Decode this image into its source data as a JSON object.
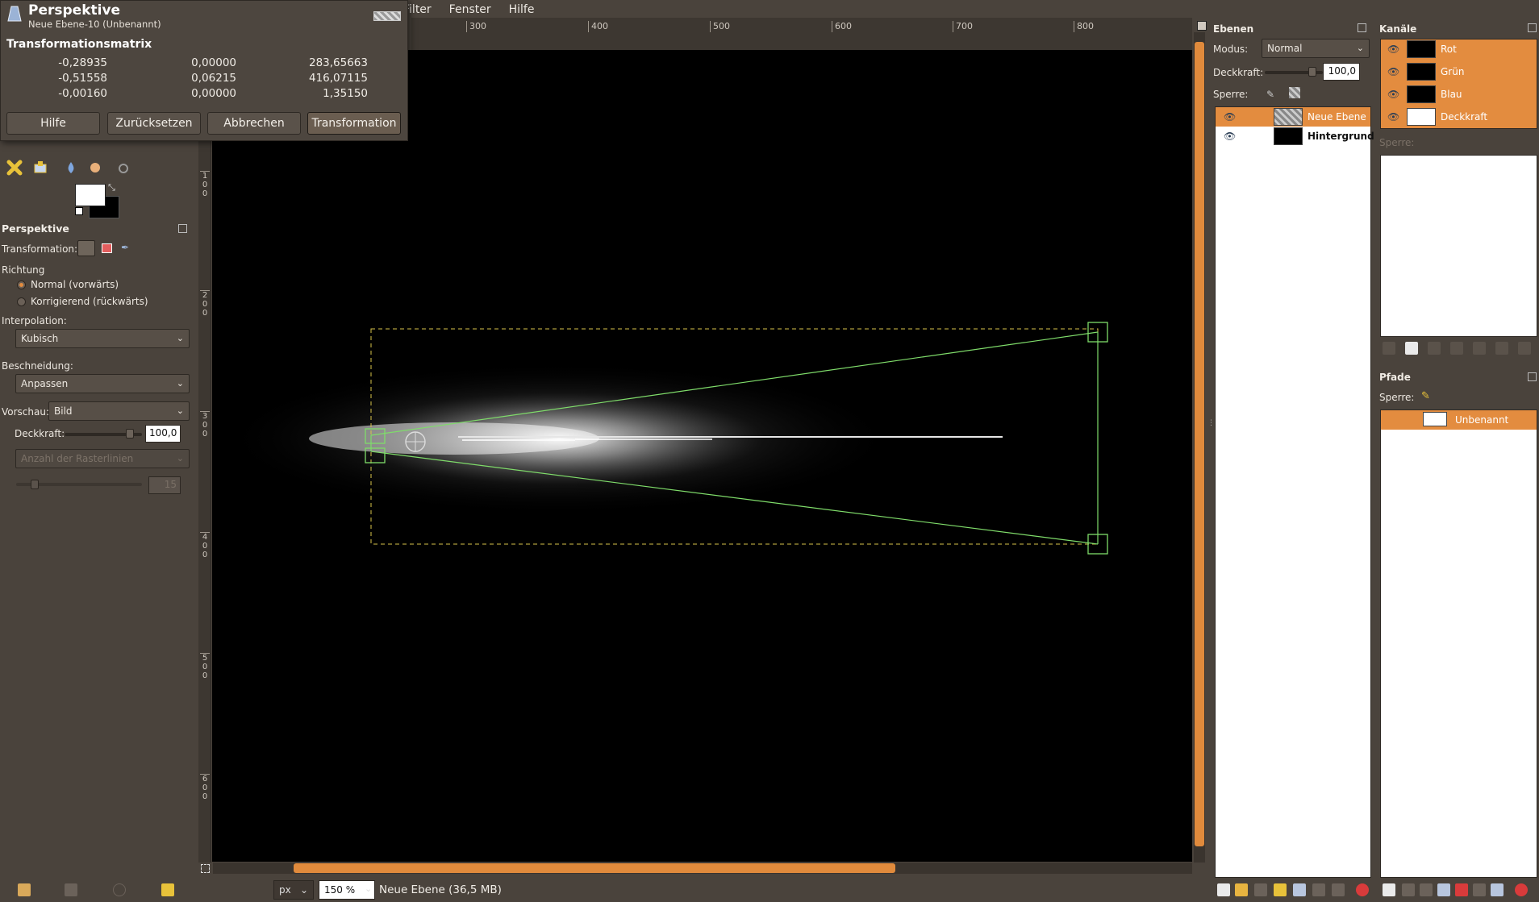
{
  "menubar": {
    "items": [
      "Filter",
      "Fenster",
      "Hilfe"
    ]
  },
  "ruler": {
    "h_ticks": [
      "300",
      "400",
      "500",
      "600",
      "700",
      "800"
    ],
    "v_ticks": [
      "1\n0\n0",
      "2\n0\n0",
      "3\n0\n0",
      "4\n0\n0",
      "5\n0\n0",
      "6\n0\n0"
    ]
  },
  "dialog": {
    "title": "Perspektive",
    "subtitle": "Neue Ebene-10 (Unbenannt)",
    "matrix_heading": "Transformationsmatrix",
    "matrix": [
      [
        "-0,28935",
        "0,00000",
        "283,65663"
      ],
      [
        "-0,51558",
        "0,06215",
        "416,07115"
      ],
      [
        "-0,00160",
        "0,00000",
        "1,35150"
      ]
    ],
    "buttons": {
      "help": "Hilfe",
      "reset": "Zurücksetzen",
      "cancel": "Abbrechen",
      "transform": "Transformation"
    }
  },
  "tool_options": {
    "title": "Perspektive",
    "transformation_label": "Transformation:",
    "direction_label": "Richtung",
    "direction_normal": "Normal (vorwärts)",
    "direction_corrective": "Korrigierend (rückwärts)",
    "interpolation_label": "Interpolation:",
    "interpolation_value": "Kubisch",
    "clipping_label": "Beschneidung:",
    "clipping_value": "Anpassen",
    "preview_label": "Vorschau:",
    "preview_value": "Bild",
    "opacity_label": "Deckkraft:",
    "opacity_value": "100,0",
    "gridlines_value": "Anzahl der Rasterlinien",
    "gridlines_count": "15"
  },
  "status": {
    "unit": "px",
    "zoom": "150 %",
    "text": "Neue Ebene (36,5 MB)"
  },
  "layers_panel": {
    "title": "Ebenen",
    "mode_label": "Modus:",
    "mode_value": "Normal",
    "opacity_label": "Deckkraft:",
    "opacity_value": "100,0",
    "lock_label": "Sperre:",
    "layers": [
      {
        "name": "Neue Ebene",
        "selected": true
      },
      {
        "name": "Hintergrund",
        "selected": false
      }
    ]
  },
  "channels_panel": {
    "title": "Kanäle",
    "channels": [
      "Rot",
      "Grün",
      "Blau",
      "Deckkraft"
    ],
    "lock_label": "Sperre:"
  },
  "paths_panel": {
    "title": "Pfade",
    "lock_label": "Sperre:",
    "paths": [
      "Unbenannt"
    ]
  },
  "colors": {
    "accent": "#e38c3f",
    "handle": "#7fdc6a",
    "bounds": "#d8c34a"
  }
}
